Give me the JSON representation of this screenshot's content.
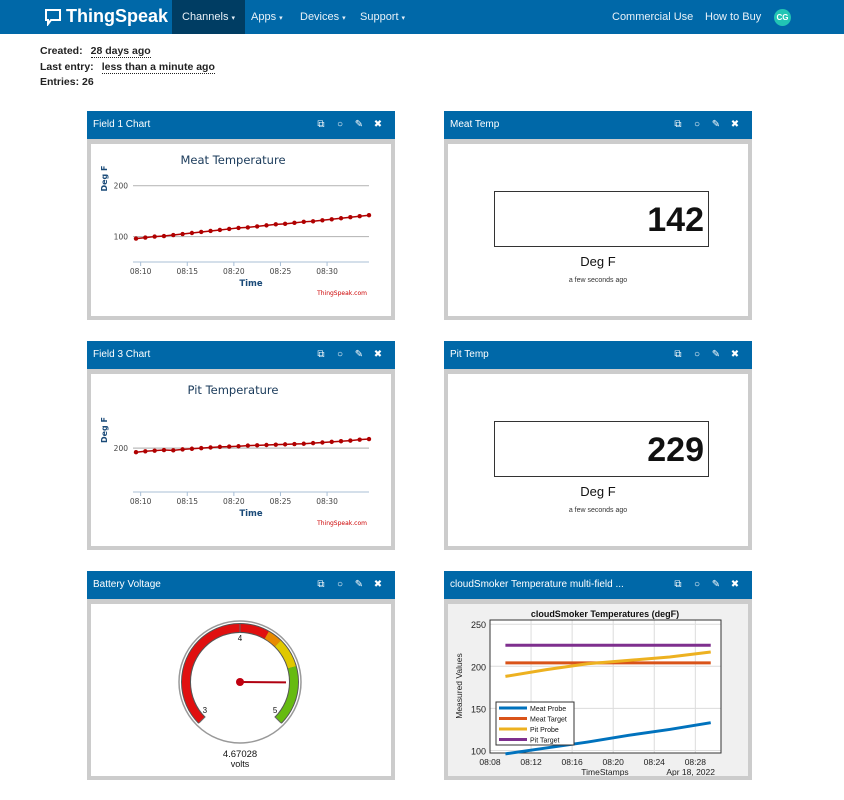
{
  "nav": {
    "brand": "ThingSpeak",
    "tm": "™",
    "items": [
      {
        "label": "Channels"
      },
      {
        "label": "Apps"
      },
      {
        "label": "Devices"
      },
      {
        "label": "Support"
      }
    ],
    "right": [
      {
        "label": "Commercial Use"
      },
      {
        "label": "How to Buy"
      }
    ],
    "avatar": "CG",
    "caret": "▾"
  },
  "info": {
    "created_label": "Created:",
    "created_value": "28 days ago",
    "last_label": "Last entry:",
    "last_value": "less than a minute ago",
    "entries": "Entries: 26"
  },
  "icons": {
    "external": "⧉",
    "comment": "○",
    "edit": "✎",
    "close": "✖"
  },
  "panels": {
    "p1": {
      "title": "Field 1 Chart"
    },
    "p2": {
      "title": "Meat Temp",
      "value": "142",
      "unit": "Deg F",
      "time": "a few seconds ago"
    },
    "p3": {
      "title": "Field 3 Chart"
    },
    "p4": {
      "title": "Pit Temp",
      "value": "229",
      "unit": "Deg F",
      "time": "a few seconds ago"
    },
    "p5": {
      "title": "Battery Voltage"
    },
    "p6": {
      "title": "cloudSmoker Temperature multi-field ..."
    }
  },
  "chart_data": [
    {
      "type": "line",
      "title": "Meat Temperature",
      "xlabel": "Time",
      "ylabel": "Deg F",
      "credit": "ThingSpeak.com",
      "color": "#b00000",
      "x_ticks": [
        "08:10",
        "08:15",
        "08:20",
        "08:25",
        "08:30"
      ],
      "y_ticks": [
        100,
        200
      ],
      "ylim": [
        50,
        280
      ],
      "xlim": [
        "08:09:30",
        "08:34:30"
      ],
      "x": [
        "08:09:30",
        "08:10:30",
        "08:11:30",
        "08:12:30",
        "08:13:30",
        "08:14:30",
        "08:15:30",
        "08:16:30",
        "08:17:30",
        "08:18:30",
        "08:19:30",
        "08:20:30",
        "08:21:30",
        "08:22:30",
        "08:23:30",
        "08:24:30",
        "08:25:30",
        "08:26:30",
        "08:27:30",
        "08:28:30",
        "08:29:30",
        "08:30:30",
        "08:31:30",
        "08:32:30",
        "08:33:30",
        "08:34:30"
      ],
      "values": [
        96,
        98,
        100,
        101,
        103,
        105,
        107,
        109,
        111,
        113,
        115,
        117,
        118,
        120,
        122,
        124,
        125,
        127,
        129,
        130,
        132,
        134,
        136,
        138,
        140,
        142
      ]
    },
    {
      "type": "line",
      "title": "Pit Temperature",
      "xlabel": "Time",
      "ylabel": "Deg F",
      "credit": "ThingSpeak.com",
      "color": "#b00000",
      "x_ticks": [
        "08:10",
        "08:15",
        "08:20",
        "08:25",
        "08:30"
      ],
      "y_ticks": [
        200
      ],
      "ylim": [
        60,
        360
      ],
      "xlim": [
        "08:09:30",
        "08:34:30"
      ],
      "x": [
        "08:09:30",
        "08:10:30",
        "08:11:30",
        "08:12:30",
        "08:13:30",
        "08:14:30",
        "08:15:30",
        "08:16:30",
        "08:17:30",
        "08:18:30",
        "08:19:30",
        "08:20:30",
        "08:21:30",
        "08:22:30",
        "08:23:30",
        "08:24:30",
        "08:25:30",
        "08:26:30",
        "08:27:30",
        "08:28:30",
        "08:29:30",
        "08:30:30",
        "08:31:30",
        "08:32:30",
        "08:33:30",
        "08:34:30"
      ],
      "values": [
        187,
        190,
        192,
        194,
        193,
        196,
        198,
        200,
        202,
        204,
        205,
        206,
        208,
        209,
        210,
        211,
        212,
        213,
        214,
        216,
        218,
        220,
        222,
        224,
        227,
        229
      ]
    },
    {
      "type": "gauge",
      "value": 4.67028,
      "value_label": "4.67028",
      "unit": "volts",
      "min": 3,
      "max": 5,
      "ticks": [
        3,
        4,
        5
      ],
      "bands": [
        {
          "from": 3,
          "to": 4.22,
          "color": "#e01010"
        },
        {
          "from": 4.22,
          "to": 4.33,
          "color": "#e88a00"
        },
        {
          "from": 4.33,
          "to": 4.55,
          "color": "#e0c800"
        },
        {
          "from": 4.55,
          "to": 5,
          "color": "#66bb11"
        }
      ]
    },
    {
      "type": "line",
      "title": "cloudSmoker Temperatures (degF)",
      "xlabel": "TimeStamps",
      "date_label": "Apr 18, 2022",
      "ylabel": "Measured Values",
      "grid": true,
      "legend": "bottom-left",
      "x_ticks": [
        "08:08",
        "08:12",
        "08:16",
        "08:20",
        "08:24",
        "08:28"
      ],
      "y_ticks": [
        100,
        150,
        200,
        250
      ],
      "ylim": [
        97,
        255
      ],
      "xlim": [
        "08:08",
        "08:30:30"
      ],
      "x": [
        "08:09:30",
        "08:13:30",
        "08:17:30",
        "08:21:30",
        "08:25:30",
        "08:29:30"
      ],
      "series": [
        {
          "name": "Meat Probe",
          "color": "#0072bd",
          "values": [
            96,
            103,
            110,
            118,
            125,
            133
          ]
        },
        {
          "name": "Meat Target",
          "color": "#d95319",
          "values": [
            204,
            204,
            204,
            204,
            204,
            204
          ]
        },
        {
          "name": "Pit Probe",
          "color": "#edb120",
          "values": [
            188,
            196,
            203,
            207,
            211,
            217
          ]
        },
        {
          "name": "Pit Target",
          "color": "#7e2f8e",
          "values": [
            225,
            225,
            225,
            225,
            225,
            225
          ]
        }
      ]
    }
  ]
}
